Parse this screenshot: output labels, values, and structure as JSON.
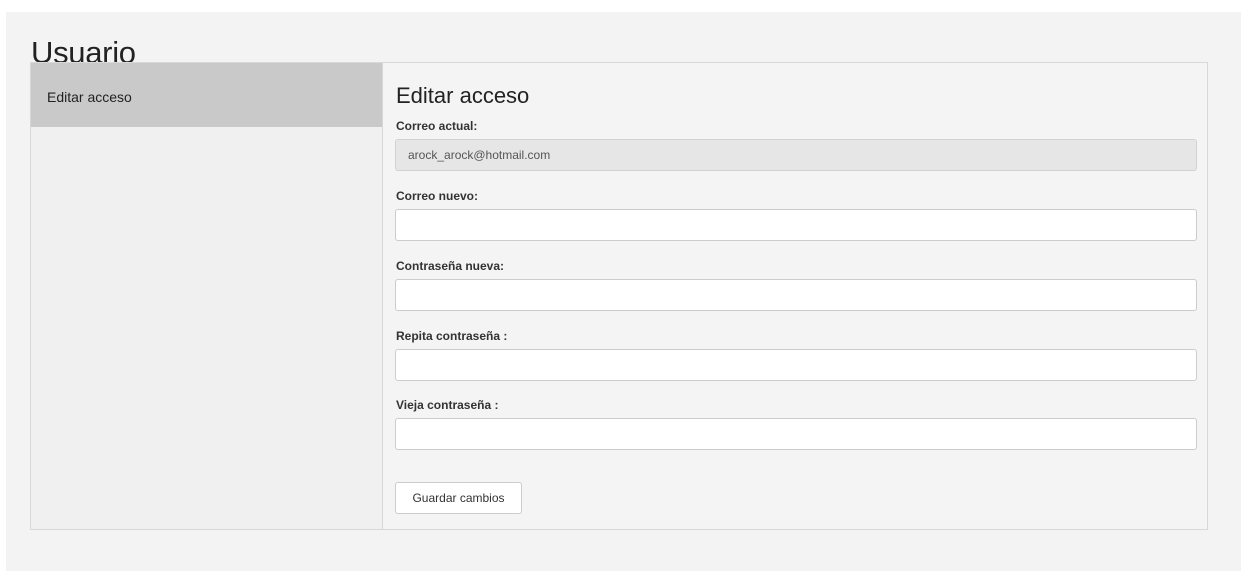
{
  "page": {
    "title": "Usuario"
  },
  "sidebar": {
    "items": [
      {
        "label": "Editar acceso",
        "active": true
      }
    ]
  },
  "form": {
    "title": "Editar acceso",
    "current_email": {
      "label": "Correo actual:",
      "value": "arock_arock@hotmail.com"
    },
    "new_email": {
      "label": "Correo nuevo:",
      "value": ""
    },
    "new_password": {
      "label": "Contraseña nueva:",
      "value": ""
    },
    "repeat_password": {
      "label": "Repita contraseña :",
      "value": ""
    },
    "old_password": {
      "label": "Vieja contraseña :",
      "value": ""
    },
    "save_label": "Guardar cambios"
  },
  "colors": {
    "page_background": "#f3f3f3",
    "sidebar_active": "#c9c9c9",
    "readonly_field": "#e6e6e6"
  }
}
